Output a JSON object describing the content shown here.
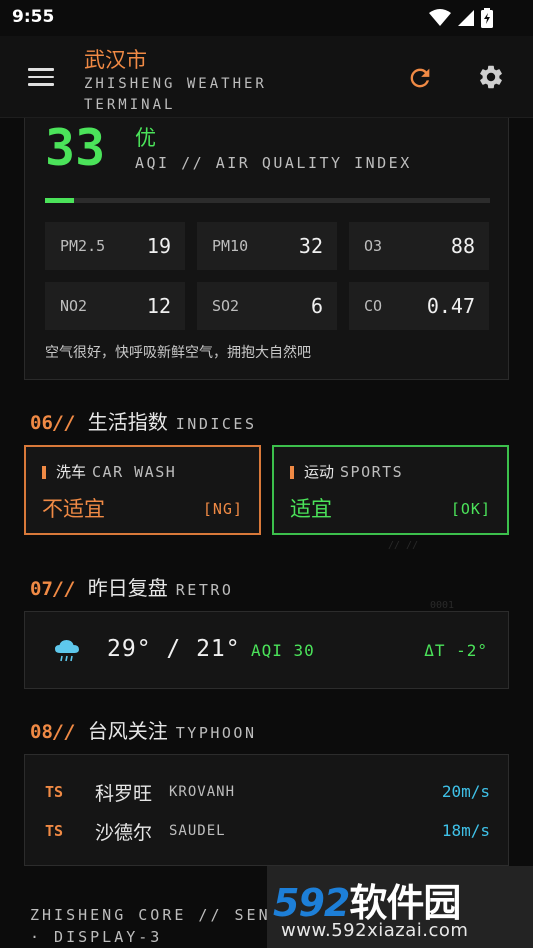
{
  "status_bar": {
    "time": "9:55"
  },
  "app_bar": {
    "city": "武汉市",
    "subtitle": "ZHISHENG WEATHER TERMINAL"
  },
  "aqi": {
    "value": "33",
    "level": "优",
    "label": "AQI // AIR QUALITY INDEX",
    "bar_fraction": 0.066,
    "pollutants": [
      {
        "name": "PM2.5",
        "value": "19"
      },
      {
        "name": "PM10",
        "value": "32"
      },
      {
        "name": "O3",
        "value": "88"
      },
      {
        "name": "NO2",
        "value": "12"
      },
      {
        "name": "SO2",
        "value": "6"
      },
      {
        "name": "CO",
        "value": "0.47"
      }
    ],
    "advice": "空气很好，快呼吸新鲜空气，拥抱大自然吧"
  },
  "sections": {
    "indices": {
      "num": "06",
      "slash": "//",
      "cn": "生活指数",
      "en": "INDICES"
    },
    "retro": {
      "num": "07",
      "slash": "//",
      "cn": "昨日复盘",
      "en": "RETRO"
    },
    "typhoon": {
      "num": "08",
      "slash": "//",
      "cn": "台风关注",
      "en": "TYPHOON"
    }
  },
  "indices": [
    {
      "cn": "洗车",
      "en": "CAR WASH",
      "status": "不适宜",
      "tag": "[NG]",
      "color": "#f08a45"
    },
    {
      "cn": "运动",
      "en": "SPORTS",
      "status": "适宜",
      "tag": "[OK]",
      "color": "#4be35a"
    }
  ],
  "retro": {
    "icon": "rain-cloud-icon",
    "temp": "29° / 21°",
    "aqi": "AQI 30",
    "delta": "ΔT -2°"
  },
  "typhoons": [
    {
      "tag": "TS",
      "cn": "科罗旺",
      "en": "KROVANH",
      "speed": "20m/s"
    },
    {
      "tag": "TS",
      "cn": "沙德尔",
      "en": "SAUDEL",
      "speed": "18m/s"
    }
  ],
  "footer": {
    "line1": "ZHISHENG CORE // SEN",
    "line2": "· DISPLAY-3"
  },
  "watermark": {
    "logo_num": "592",
    "logo_text": "软件园",
    "url": "www.592xiazai.com"
  },
  "colors": {
    "accent": "#f08a45",
    "good": "#4be35a",
    "speed": "#3fc1e8",
    "background": "#0c0c0c"
  }
}
